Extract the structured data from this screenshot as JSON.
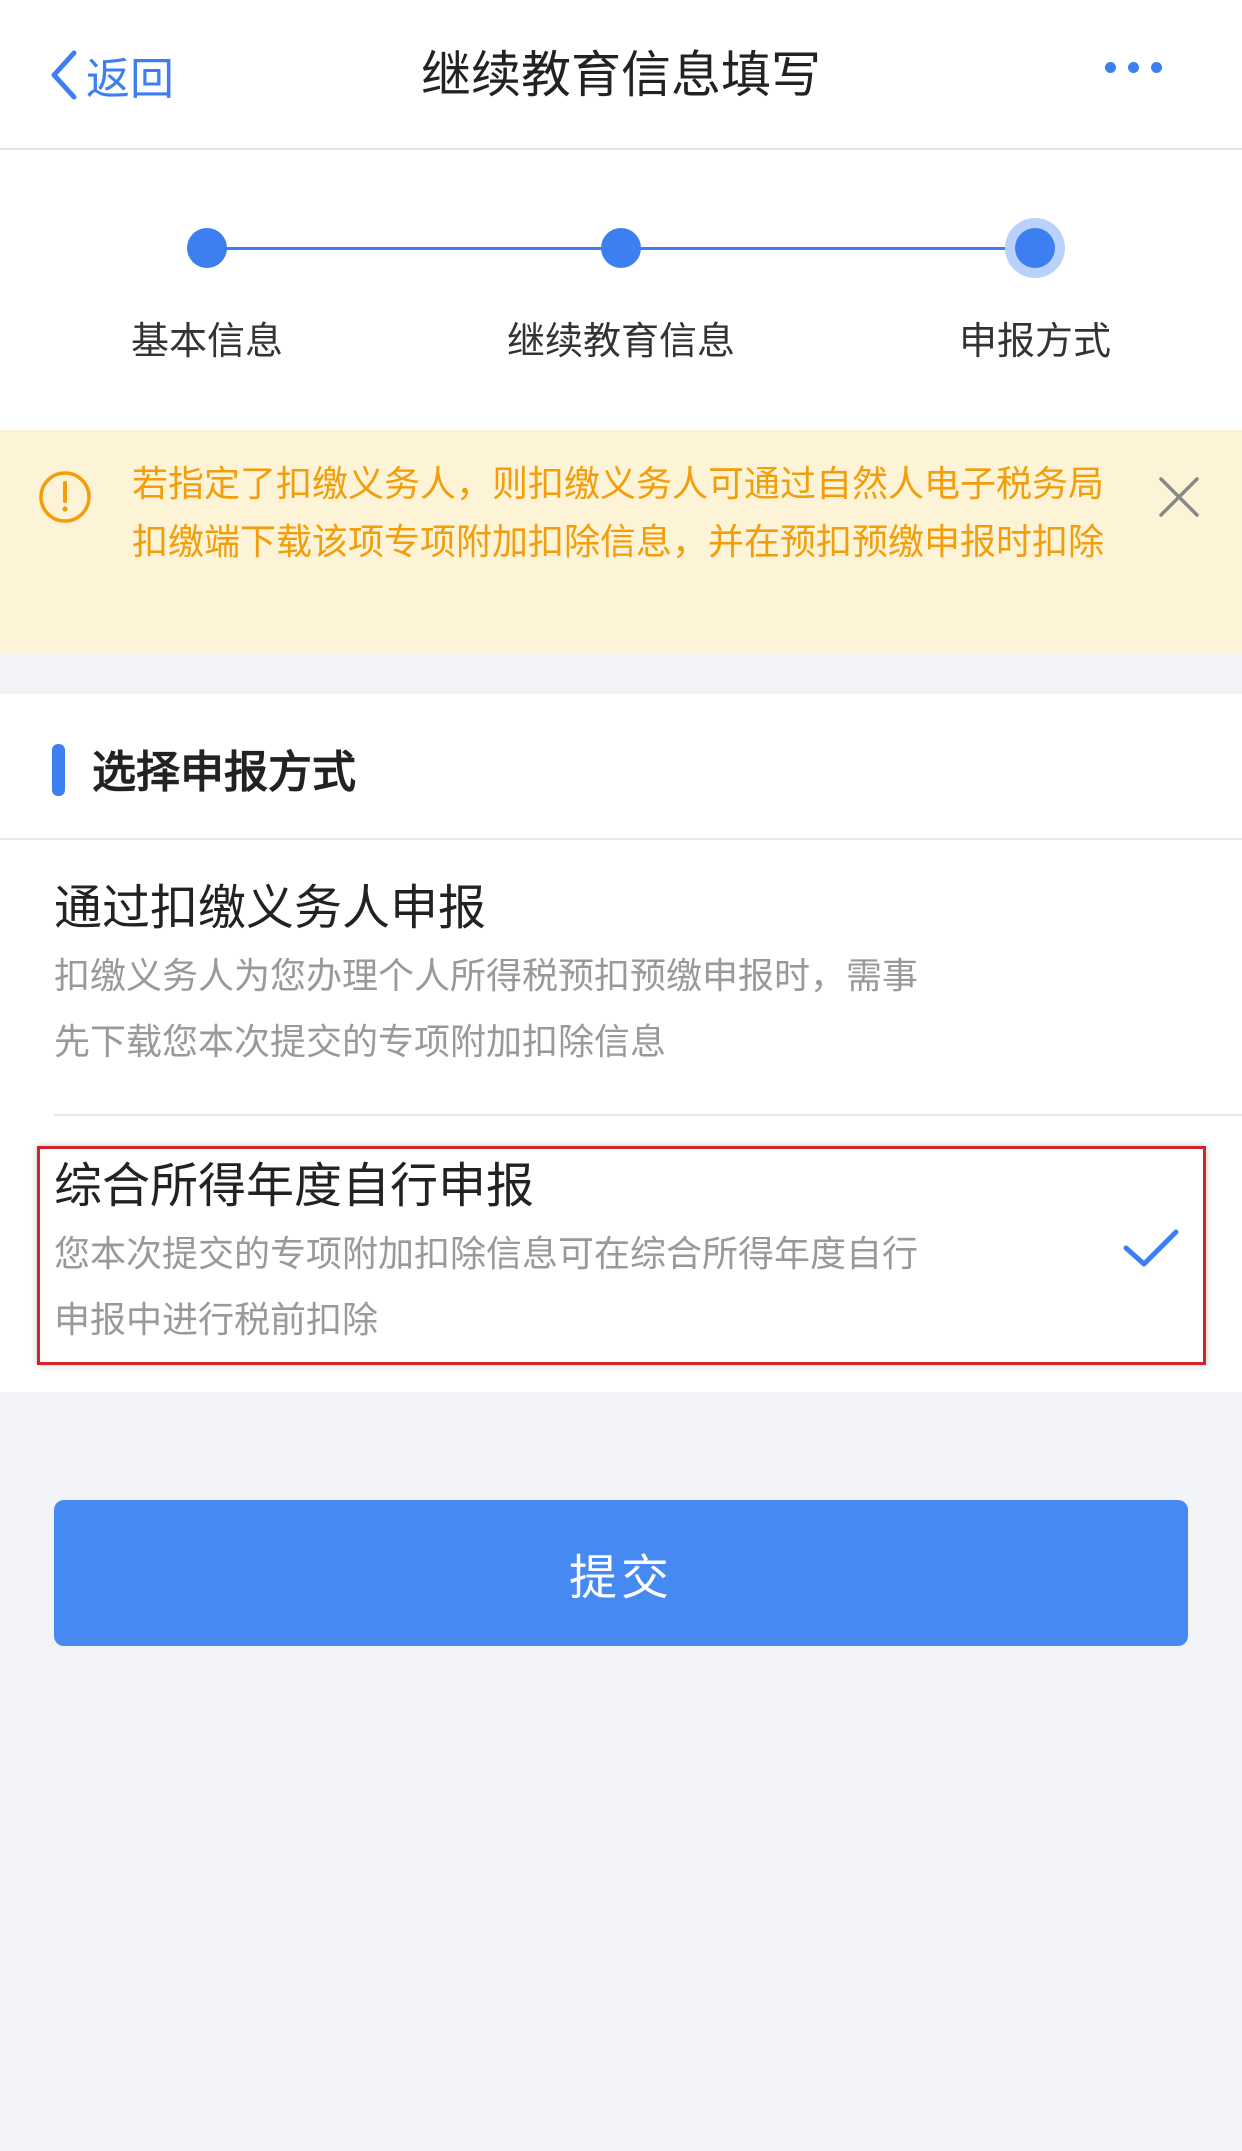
{
  "header": {
    "back_label": "返回",
    "title": "继续教育信息填写"
  },
  "steps": [
    {
      "label": "基本信息"
    },
    {
      "label": "继续教育信息"
    },
    {
      "label": "申报方式"
    }
  ],
  "notice": {
    "text": "若指定了扣缴义务人，则扣缴义务人可通过自然人电子税务局扣缴端下载该项专项附加扣除信息，并在预扣预缴申报时扣除"
  },
  "section": {
    "title": "选择申报方式"
  },
  "options": [
    {
      "title": "通过扣缴义务人申报",
      "desc_line1": "扣缴义务人为您办理个人所得税预扣预缴申报时，需事",
      "desc_line2": "先下载您本次提交的专项附加扣除信息"
    },
    {
      "title": "综合所得年度自行申报",
      "desc_line1": "您本次提交的专项附加扣除信息可在综合所得年度自行",
      "desc_line2": "申报中进行税前扣除"
    }
  ],
  "submit_label": "提交",
  "colors": {
    "accent": "#3d7ff0",
    "notice_text": "#f29e0c",
    "notice_bg": "#fdf3d6",
    "highlight_border": "#d0252b"
  }
}
